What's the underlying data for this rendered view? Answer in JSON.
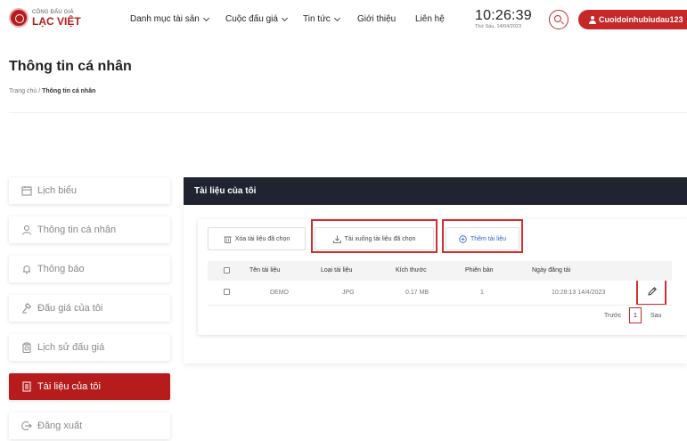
{
  "header": {
    "logo_small": "CÔNG ĐẤU GIÁ",
    "logo_big": "LẠC VIỆT",
    "nav": [
      {
        "label": "Danh mục tài sản",
        "dropdown": true
      },
      {
        "label": "Cuộc đấu giá",
        "dropdown": true
      },
      {
        "label": "Tin tức",
        "dropdown": true
      },
      {
        "label": "Giới thiệu",
        "dropdown": false
      },
      {
        "label": "Liên hệ",
        "dropdown": false
      }
    ],
    "clock_time": "10:26:39",
    "clock_date": "Thứ Sáu, 14/04/2023",
    "user_name": "Cuoidoinhubiudau123"
  },
  "page": {
    "title": "Thông tin cá nhân",
    "breadcrumb_home": "Trang chủ",
    "breadcrumb_sep": " / ",
    "breadcrumb_current": "Thông tin cá nhân"
  },
  "sidebar": {
    "items": [
      {
        "label": "Lịch biểu",
        "icon": "calendar-icon",
        "active": false
      },
      {
        "label": "Thông tin cá nhân",
        "icon": "user-icon",
        "active": false
      },
      {
        "label": "Thông báo",
        "icon": "bell-icon",
        "active": false
      },
      {
        "label": "Đấu giá của tôi",
        "icon": "gavel-icon",
        "active": false
      },
      {
        "label": "Lịch sử đấu giá",
        "icon": "clipboard-icon",
        "active": false
      },
      {
        "label": "Tài liệu của tôi",
        "icon": "document-icon",
        "active": true
      },
      {
        "label": "Đăng xuất",
        "icon": "logout-icon",
        "active": false
      }
    ]
  },
  "documents": {
    "title": "Tài liệu của tôi",
    "actions": {
      "delete_label": "Xóa tài liệu đã chọn",
      "download_label": "Tải xuống tài liệu đã chọn",
      "add_label": "Thêm tài liệu"
    },
    "columns": [
      "Tên tài liệu",
      "Loại tài liệu",
      "Kích thước",
      "Phiên bản",
      "Ngày đăng tải"
    ],
    "rows": [
      {
        "name": "DEMO",
        "type": "JPG",
        "size": "0.17 MB",
        "version": "1",
        "uploaded": "10:28:13 14/4/2023"
      }
    ],
    "pagination": {
      "prev_label": "Trước",
      "current_page": "1",
      "next_label": "Sau"
    }
  },
  "colors": {
    "brand_red": "#c62828",
    "active_red": "#b71c1c",
    "panel_dark": "#1f2430",
    "highlight_red": "#d32f2f",
    "link_blue": "#3465c4"
  }
}
